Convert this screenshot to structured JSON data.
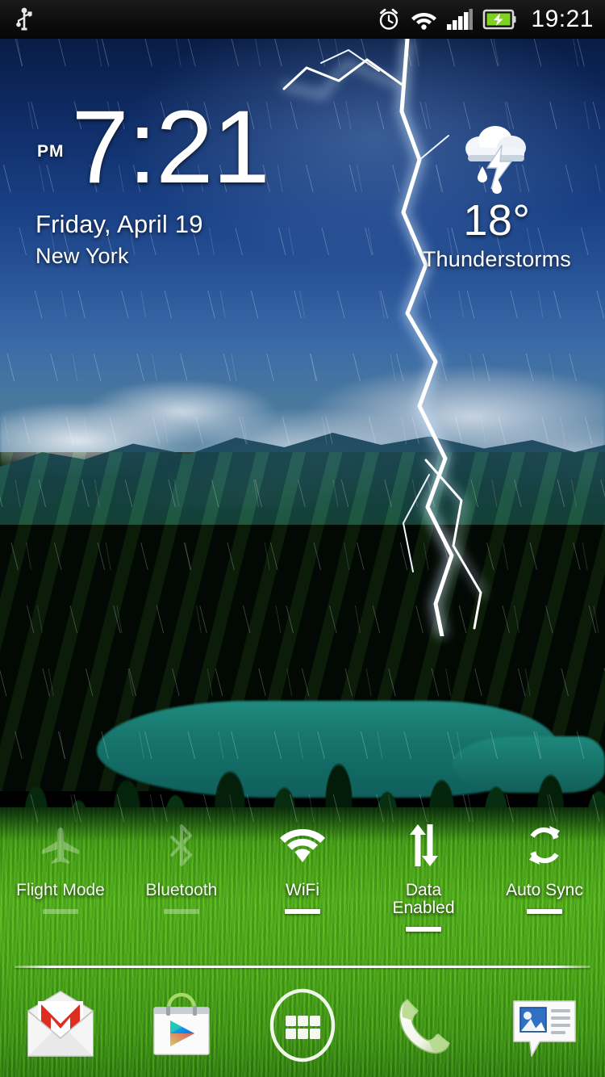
{
  "status_bar": {
    "clock": "19:21",
    "left_icons": [
      {
        "name": "usb-icon",
        "label": "USB connected"
      }
    ],
    "right_icons": [
      {
        "name": "alarm-clock-icon",
        "label": "Alarm set"
      },
      {
        "name": "wifi-signal-icon",
        "label": "WiFi connected"
      },
      {
        "name": "cellular-signal-icon",
        "label": "Cellular signal"
      },
      {
        "name": "battery-charging-icon",
        "label": "Battery charging"
      }
    ],
    "colors": {
      "background": "#0d0d0d",
      "text": "#ffffff",
      "battery_fill": "#7ed321"
    }
  },
  "clock_widget": {
    "ampm": "PM",
    "time": "7:21",
    "date": "Friday, April 19",
    "city": "New York"
  },
  "weather_widget": {
    "icon": "thunderstorm-rain-icon",
    "temperature": "18°",
    "condition": "Thunderstorms"
  },
  "toggles": [
    {
      "label": "Flight Mode",
      "icon": "airplane-icon",
      "state": "off"
    },
    {
      "label": "Bluetooth",
      "icon": "bluetooth-icon",
      "state": "off"
    },
    {
      "label": "WiFi",
      "icon": "wifi-icon",
      "state": "on"
    },
    {
      "label": "Data\nEnabled",
      "label_line1": "Data",
      "label_line2": "Enabled",
      "icon": "data-transfer-arrows-icon",
      "state": "on"
    },
    {
      "label": "Auto Sync",
      "icon": "sync-refresh-icon",
      "state": "on"
    }
  ],
  "dock": [
    {
      "name": "gmail",
      "label": "Gmail",
      "icon": "gmail-envelope-icon"
    },
    {
      "name": "play-store",
      "label": "Play Store",
      "icon": "play-store-bag-icon"
    },
    {
      "name": "app-drawer",
      "label": "Apps",
      "icon": "app-drawer-grid-icon"
    },
    {
      "name": "phone",
      "label": "Phone",
      "icon": "phone-handset-icon"
    },
    {
      "name": "messaging",
      "label": "Messaging",
      "icon": "messaging-bubble-icon"
    }
  ],
  "wallpaper": {
    "description": "Thunderstorm live wallpaper: lightning over green valley with lake",
    "colors": {
      "sky_top": "#071530",
      "sky_mid": "#2a5598",
      "hills": "#0a3418",
      "lake": "#16736c",
      "grass": "#57b81d",
      "lightning": "#ffffff"
    }
  }
}
